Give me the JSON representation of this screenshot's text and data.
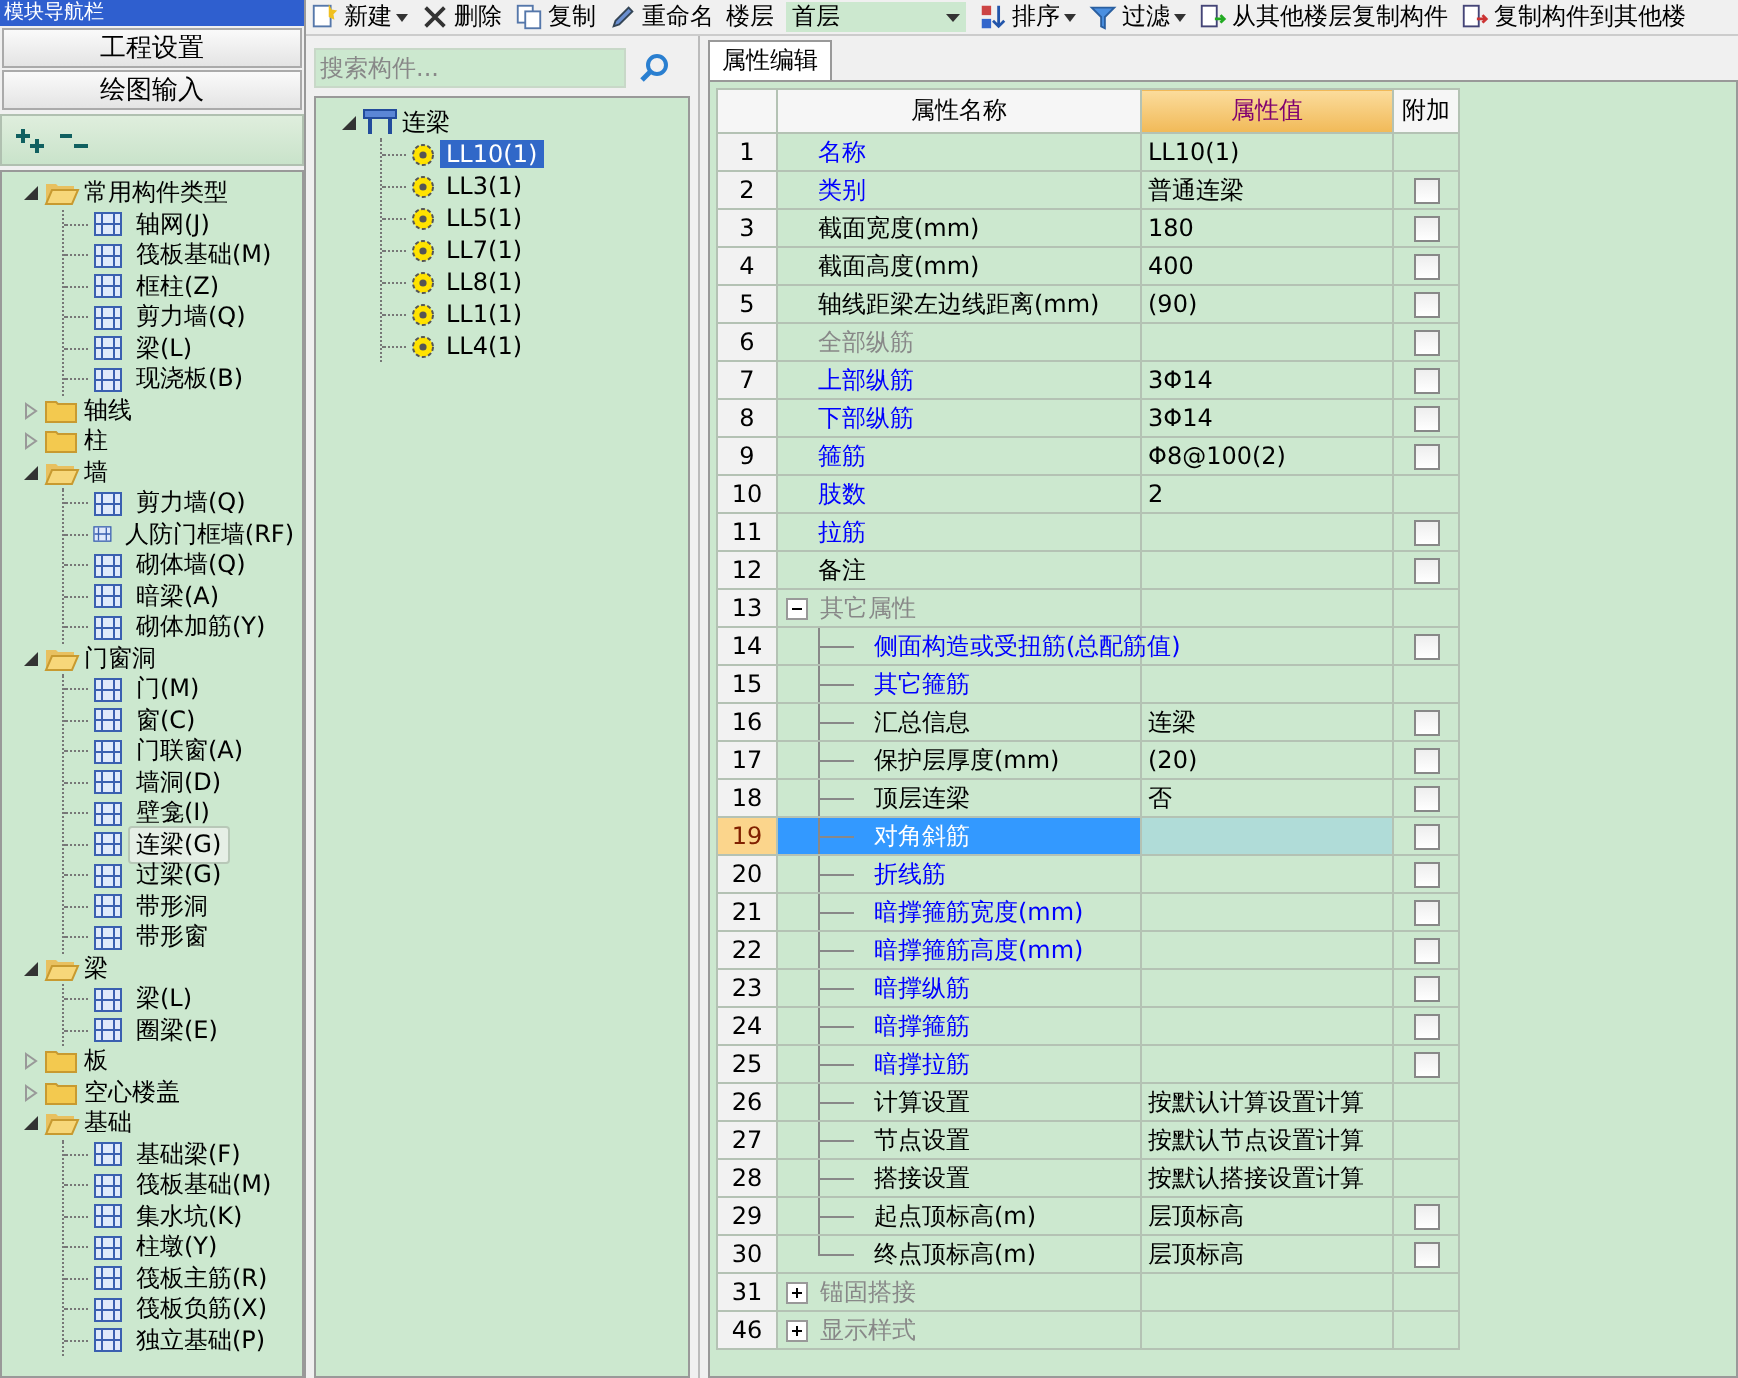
{
  "window": {
    "title": "模块导航栏"
  },
  "nav": {
    "buttons": [
      {
        "label": "工程设置"
      },
      {
        "label": "绘图输入"
      }
    ],
    "tree": [
      {
        "label": "常用构件类型",
        "expanded": true,
        "children": [
          {
            "label": "轴网(J)",
            "selected": false
          },
          {
            "label": "筏板基础(M)",
            "selected": false
          },
          {
            "label": "框柱(Z)",
            "selected": false
          },
          {
            "label": "剪力墙(Q)",
            "selected": false
          },
          {
            "label": "梁(L)",
            "selected": false
          },
          {
            "label": "现浇板(B)",
            "selected": false
          }
        ]
      },
      {
        "label": "轴线",
        "expanded": false
      },
      {
        "label": "柱",
        "expanded": false
      },
      {
        "label": "墙",
        "expanded": true,
        "children": [
          {
            "label": "剪力墙(Q)",
            "selected": false
          },
          {
            "label": "人防门框墙(RF)",
            "selected": false
          },
          {
            "label": "砌体墙(Q)",
            "selected": false
          },
          {
            "label": "暗梁(A)",
            "selected": false
          },
          {
            "label": "砌体加筋(Y)",
            "selected": false
          }
        ]
      },
      {
        "label": "门窗洞",
        "expanded": true,
        "children": [
          {
            "label": "门(M)",
            "selected": false
          },
          {
            "label": "窗(C)",
            "selected": false
          },
          {
            "label": "门联窗(A)",
            "selected": false
          },
          {
            "label": "墙洞(D)",
            "selected": false
          },
          {
            "label": "壁龛(I)",
            "selected": false
          },
          {
            "label": "连梁(G)",
            "selected": true
          },
          {
            "label": "过梁(G)",
            "selected": false
          },
          {
            "label": "带形洞",
            "selected": false
          },
          {
            "label": "带形窗",
            "selected": false
          }
        ]
      },
      {
        "label": "梁",
        "expanded": true,
        "children": [
          {
            "label": "梁(L)",
            "selected": false
          },
          {
            "label": "圈梁(E)",
            "selected": false
          }
        ]
      },
      {
        "label": "板",
        "expanded": false
      },
      {
        "label": "空心楼盖",
        "expanded": false
      },
      {
        "label": "基础",
        "expanded": true,
        "children": [
          {
            "label": "基础梁(F)",
            "selected": false
          },
          {
            "label": "筏板基础(M)",
            "selected": false
          },
          {
            "label": "集水坑(K)",
            "selected": false
          },
          {
            "label": "柱墩(Y)",
            "selected": false
          },
          {
            "label": "筏板主筋(R)",
            "selected": false
          },
          {
            "label": "筏板负筋(X)",
            "selected": false
          },
          {
            "label": "独立基础(P)",
            "selected": false
          }
        ]
      }
    ]
  },
  "toolbar": [
    {
      "kind": "button",
      "label": "新建",
      "dropdown": true
    },
    {
      "kind": "button",
      "label": "删除",
      "dropdown": false
    },
    {
      "kind": "button",
      "label": "复制",
      "dropdown": false
    },
    {
      "kind": "button",
      "label": "重命名",
      "dropdown": false
    },
    {
      "kind": "label",
      "label": "楼层"
    },
    {
      "kind": "select",
      "value": "首层"
    },
    {
      "kind": "button",
      "label": "排序",
      "dropdown": true
    },
    {
      "kind": "button",
      "label": "过滤",
      "dropdown": true
    },
    {
      "kind": "button",
      "label": "从其他楼层复制构件",
      "dropdown": false
    },
    {
      "kind": "button",
      "label": "复制构件到其他楼",
      "dropdown": false
    }
  ],
  "component_list": {
    "search": {
      "placeholder": "搜索构件..."
    },
    "tree": [
      {
        "label": "连梁",
        "expanded": true,
        "children": [
          {
            "label": "LL10(1)",
            "selected": true
          },
          {
            "label": "LL3(1)",
            "selected": false
          },
          {
            "label": "LL5(1)",
            "selected": false
          },
          {
            "label": "LL7(1)",
            "selected": false
          },
          {
            "label": "LL8(1)",
            "selected": false
          },
          {
            "label": "LL1(1)",
            "selected": false
          },
          {
            "label": "LL4(1)",
            "selected": false
          }
        ]
      }
    ]
  },
  "tabs": [
    {
      "label": "属性编辑",
      "selected": true
    }
  ],
  "property_table": {
    "columns": [
      {
        "label": "属性名称",
        "highlighted": false
      },
      {
        "label": "属性值",
        "highlighted": true
      },
      {
        "label": "附加",
        "highlighted": false
      }
    ],
    "rows": [
      {
        "num": "1",
        "name": "名称",
        "value": "LL10(1)",
        "kind": "link",
        "selected": false
      },
      {
        "num": "2",
        "name": "类别",
        "value": "普通连梁",
        "kind": "link",
        "selected": false,
        "checked": false
      },
      {
        "num": "3",
        "name": "截面宽度(mm)",
        "value": "180",
        "kind": "plain",
        "selected": false,
        "checked": false
      },
      {
        "num": "4",
        "name": "截面高度(mm)",
        "value": "400",
        "kind": "plain",
        "selected": false,
        "checked": false
      },
      {
        "num": "5",
        "name": "轴线距梁左边线距离(mm)",
        "value": "(90)",
        "kind": "plain",
        "selected": false,
        "checked": false
      },
      {
        "num": "6",
        "name": "全部纵筋",
        "kind": "disabled",
        "selected": false,
        "checked": false
      },
      {
        "num": "7",
        "name": "上部纵筋",
        "value": "3Φ14",
        "kind": "link",
        "selected": false,
        "checked": false
      },
      {
        "num": "8",
        "name": "下部纵筋",
        "value": "3Φ14",
        "kind": "link",
        "selected": false,
        "checked": false
      },
      {
        "num": "9",
        "name": "箍筋",
        "value": "Φ8@100(2)",
        "kind": "link",
        "selected": false,
        "checked": false
      },
      {
        "num": "10",
        "name": "肢数",
        "value": "2",
        "kind": "link",
        "selected": false
      },
      {
        "num": "11",
        "name": "拉筋",
        "kind": "link",
        "selected": false,
        "checked": false
      },
      {
        "num": "12",
        "name": "备注",
        "kind": "plain",
        "selected": false,
        "checked": false
      },
      {
        "num": "13",
        "name": "其它属性",
        "kind": "group",
        "expanded": true,
        "selected": false,
        "children": [
          {
            "num": "14",
            "name": "侧面构造或受扭筋(总配筋值)",
            "kind": "link",
            "selected": false,
            "checked": false
          },
          {
            "num": "15",
            "name": "其它箍筋",
            "kind": "link",
            "selected": false
          },
          {
            "num": "16",
            "name": "汇总信息",
            "value": "连梁",
            "kind": "plain",
            "selected": false,
            "checked": false
          },
          {
            "num": "17",
            "name": "保护层厚度(mm)",
            "value": "(20)",
            "kind": "plain",
            "selected": false,
            "checked": false
          },
          {
            "num": "18",
            "name": "顶层连梁",
            "value": "否",
            "kind": "plain",
            "selected": false,
            "checked": false
          },
          {
            "num": "19",
            "name": "对角斜筋",
            "kind": "link",
            "selected": true,
            "checked": false
          },
          {
            "num": "20",
            "name": "折线筋",
            "kind": "link",
            "selected": false,
            "checked": false
          },
          {
            "num": "21",
            "name": "暗撑箍筋宽度(mm)",
            "kind": "link",
            "selected": false,
            "checked": false
          },
          {
            "num": "22",
            "name": "暗撑箍筋高度(mm)",
            "kind": "link",
            "selected": false,
            "checked": false
          },
          {
            "num": "23",
            "name": "暗撑纵筋",
            "kind": "link",
            "selected": false,
            "checked": false
          },
          {
            "num": "24",
            "name": "暗撑箍筋",
            "kind": "link",
            "selected": false,
            "checked": false
          },
          {
            "num": "25",
            "name": "暗撑拉筋",
            "kind": "link",
            "selected": false,
            "checked": false
          },
          {
            "num": "26",
            "name": "计算设置",
            "value": "按默认计算设置计算",
            "kind": "plain",
            "selected": false
          },
          {
            "num": "27",
            "name": "节点设置",
            "value": "按默认节点设置计算",
            "kind": "plain",
            "selected": false
          },
          {
            "num": "28",
            "name": "搭接设置",
            "value": "按默认搭接设置计算",
            "kind": "plain",
            "selected": false
          },
          {
            "num": "29",
            "name": "起点顶标高(m)",
            "value": "层顶标高",
            "kind": "plain",
            "selected": false,
            "checked": false
          },
          {
            "num": "30",
            "name": "终点顶标高(m)",
            "value": "层顶标高",
            "kind": "plain",
            "selected": false,
            "checked": false
          }
        ]
      },
      {
        "num": "31",
        "name": "锚固搭接",
        "kind": "group",
        "expanded": false,
        "selected": false
      },
      {
        "num": "46",
        "name": "显示样式",
        "kind": "group",
        "expanded": false,
        "selected": false
      }
    ]
  }
}
